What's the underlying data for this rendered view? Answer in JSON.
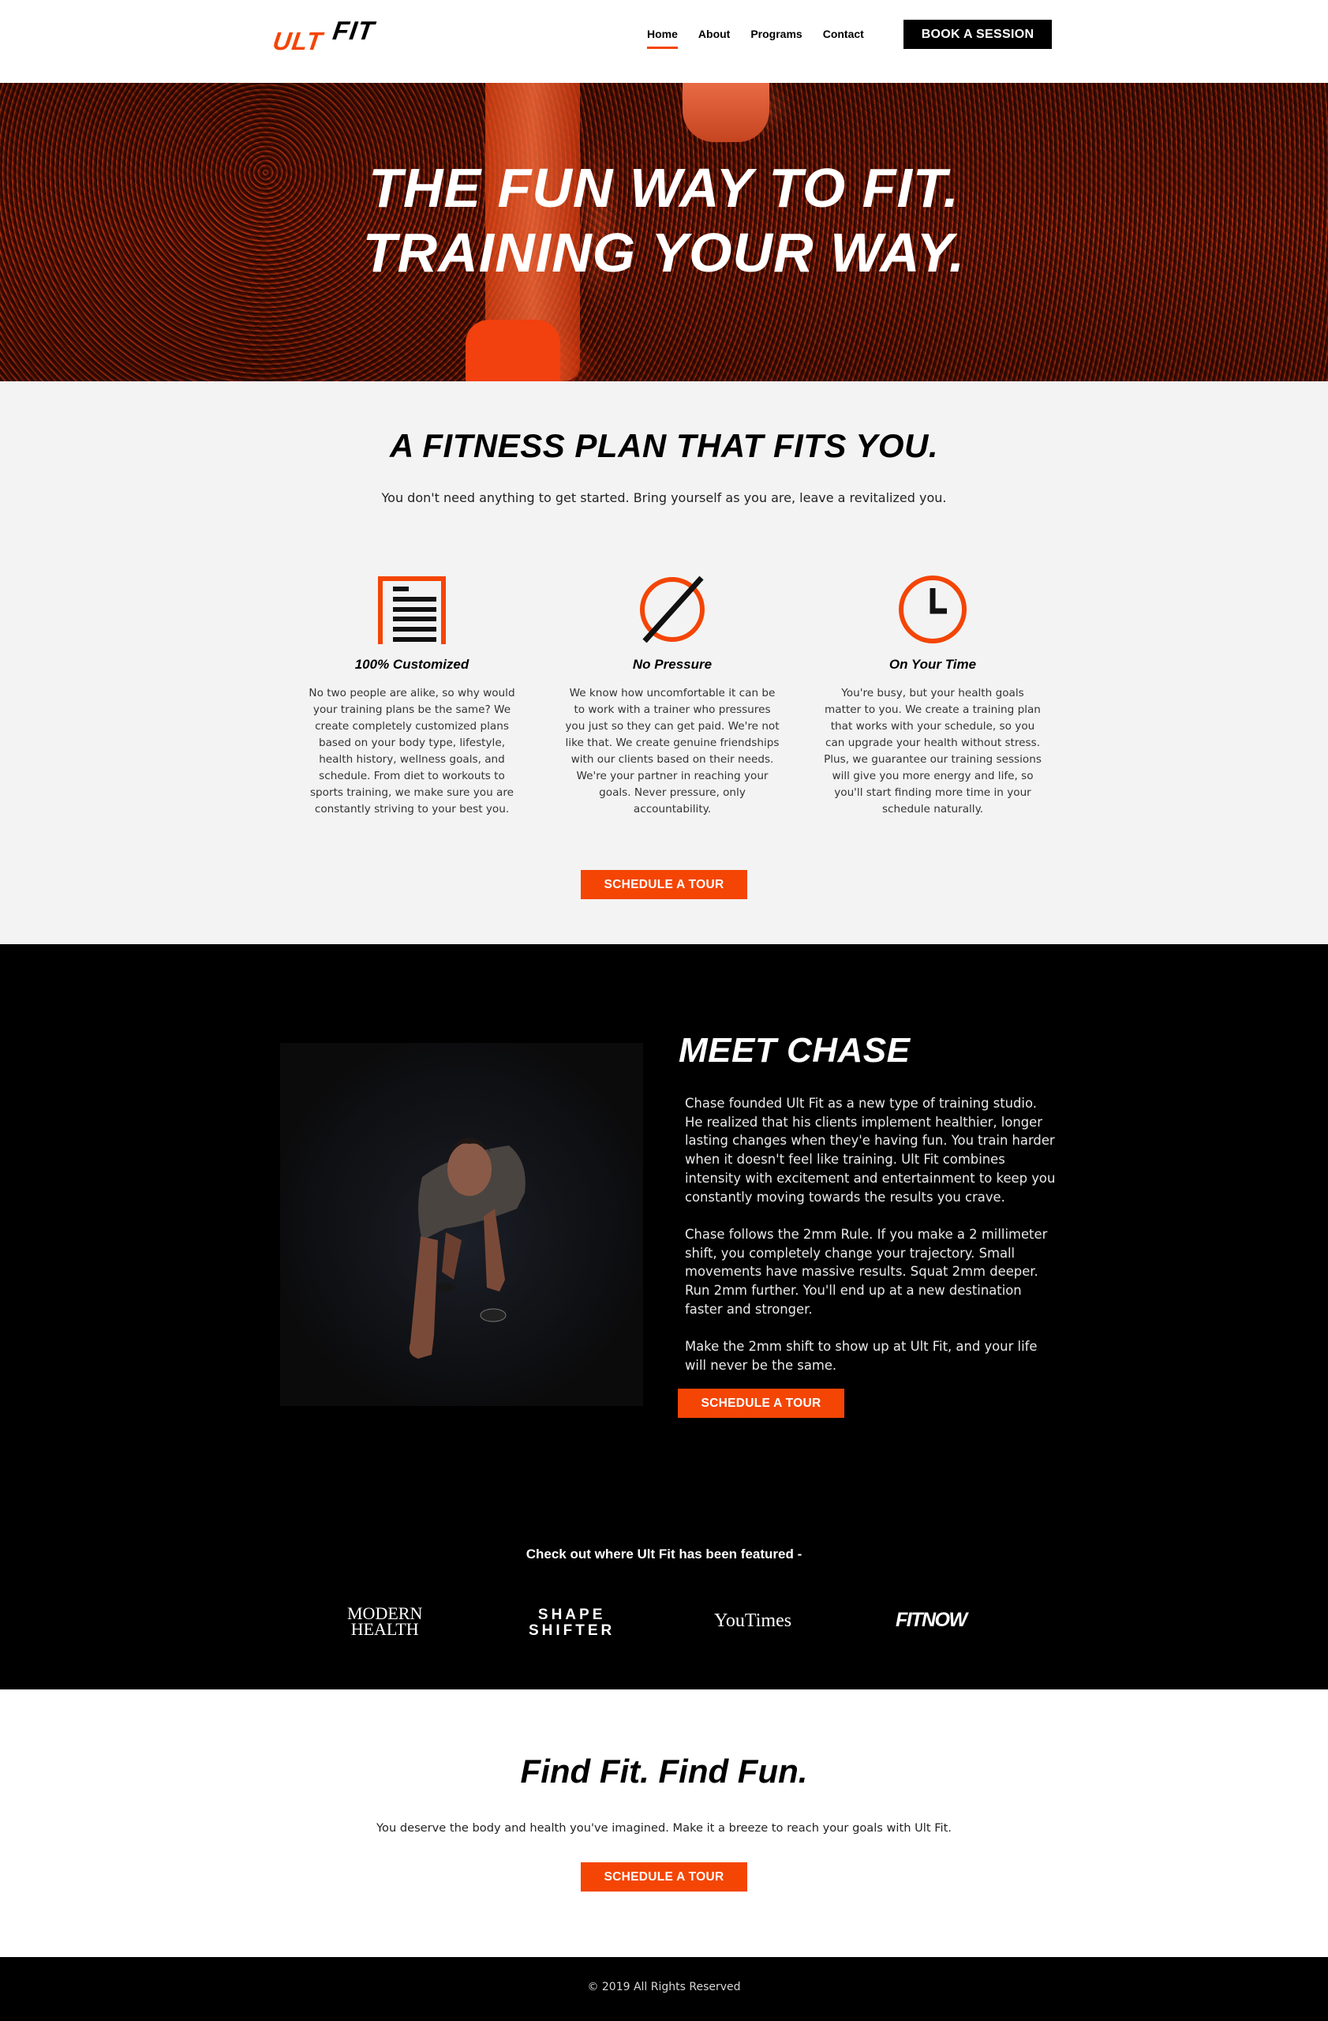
{
  "header": {
    "logo": {
      "part1": "ULT",
      "part2": "FIT"
    },
    "nav": [
      {
        "label": "Home",
        "active": true
      },
      {
        "label": "About",
        "active": false
      },
      {
        "label": "Programs",
        "active": false
      },
      {
        "label": "Contact",
        "active": false
      }
    ],
    "cta_label": "BOOK A SESSION"
  },
  "hero": {
    "line1": "THE FUN WAY TO FIT.",
    "line2": "TRAINING YOUR WAY."
  },
  "plan": {
    "title": "A FITNESS PLAN THAT FITS YOU.",
    "subtitle": "You don't need anything to get started. Bring yourself as you are, leave a revitalized you.",
    "features": [
      {
        "icon": "document-list-icon",
        "title": "100% Customized",
        "text": "No two people are alike, so why would your training plans be the same? We create completely customized plans based on your body type, lifestyle, health history, wellness goals, and schedule. From diet to workouts to sports training, we make sure you are constantly striving to your best you."
      },
      {
        "icon": "no-symbol-icon",
        "title": "No Pressure",
        "text": "We know how uncomfortable it can be to work with a trainer who pressures you just so they can get paid. We're not like that. We create genuine friendships with our clients based on their needs. We're your partner in reaching your goals. Never pressure, only accountability."
      },
      {
        "icon": "clock-icon",
        "title": "On Your Time",
        "text": "You're busy, but your health goals matter to you. We create a training plan that works with your schedule, so you can upgrade your health without stress. Plus, we guarantee our training sessions will give you more energy and life, so you'll start finding more time in your schedule naturally."
      }
    ],
    "button_label": "SCHEDULE A TOUR"
  },
  "meet": {
    "title": "MEET CHASE",
    "paragraphs": [
      "Chase founded Ult Fit as a new type of training studio. He realized that his clients implement healthier, longer lasting changes when they'e having fun. You train harder when it doesn't feel like training. Ult Fit combines intensity with excitement and entertainment to keep you constantly moving towards the results you crave.",
      "Chase follows the 2mm Rule. If you make a 2 millimeter shift, you completely change your trajectory. Small movements have massive results. Squat 2mm deeper. Run 2mm further. You'll end up at a new destination faster and stronger.",
      "Make the 2mm shift to show up at Ult Fit, and your life will never be the same."
    ],
    "button_label": "SCHEDULE A TOUR",
    "photo_alt": "Chase in sprinter starting position",
    "featured_title": "Check out where Ult Fit has been featured -",
    "publications": [
      {
        "line1": "MODERN",
        "line2": "HEALTH"
      },
      {
        "line1": "SHAPE",
        "line2": "SHIFTER"
      },
      {
        "line1": "YouTimes",
        "line2": ""
      },
      {
        "line1": "FITNOW",
        "line2": ""
      }
    ]
  },
  "cta": {
    "title": "Find Fit. Find Fun.",
    "text": "You deserve the body and health you've imagined. Make it a breeze to reach your goals with Ult Fit.",
    "button_label": "SCHEDULE A TOUR"
  },
  "footer": {
    "copyright": "© 2019 All Rights Reserved"
  },
  "colors": {
    "accent": "#f44505",
    "dark": "#000000",
    "light_bg": "#f3f3f3"
  }
}
